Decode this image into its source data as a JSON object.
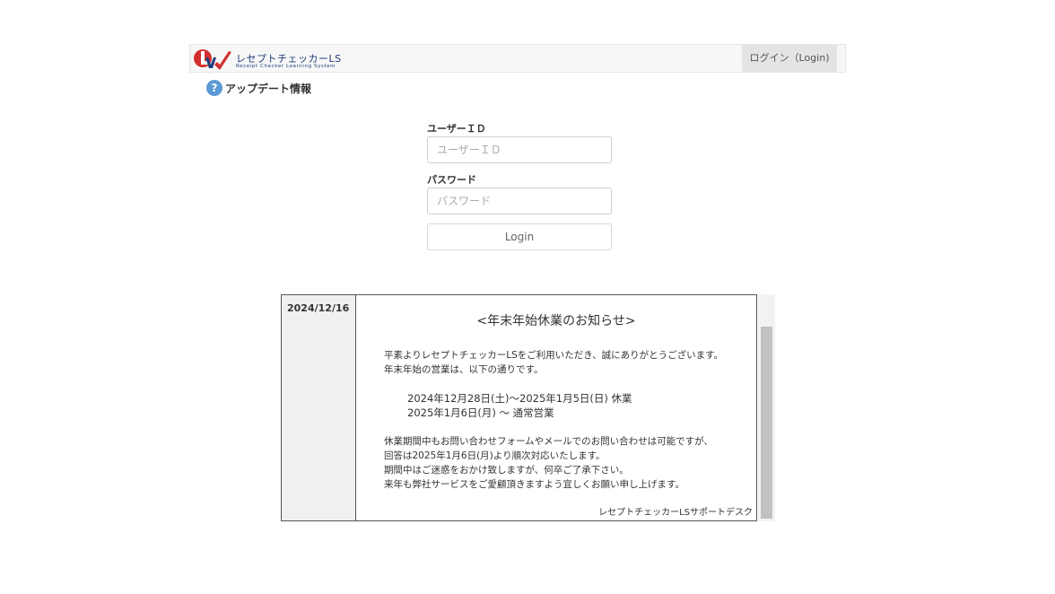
{
  "header": {
    "logo_title": "レセプトチェッカーLS",
    "logo_subtitle": "Receipt Checker Learning System",
    "login_link": "ログイン（Login)"
  },
  "update_info": {
    "icon": "question-icon",
    "label": "アップデート情報"
  },
  "login_form": {
    "user_id_label": "ユーザーＩＤ",
    "user_id_placeholder": "ユーザーＩＤ",
    "user_id_value": "",
    "password_label": "パスワード",
    "password_placeholder": "パスワード",
    "password_value": "",
    "login_button": "Login"
  },
  "news": {
    "date": "2024/12/16",
    "title": "<年末年始休業のお知らせ>",
    "lines": [
      "平素よりレセプトチェッカーLSをご利用いただき、誠にありがとうございます。",
      "年末年始の営業は、以下の通りです。",
      "",
      "2024年12月28日(土)～2025年1月5日(日)  休業",
      "2025年1月6日(月) ～ 通常営業",
      "",
      "休業期間中もお問い合わせフォームやメールでのお問い合わせは可能ですが、",
      "回答は2025年1月6日(月)より順次対応いたします。",
      "期間中はご迷惑をおかけ致しますが、何卒ご了承下さい。",
      "来年も弊社サービスをご愛顧頂きますよう宜しくお願い申し上げます。"
    ],
    "signature": "レセプトチェッカーLSサポートデスク"
  },
  "colors": {
    "logo_red": "#d32f2f",
    "logo_blue": "#1f3c7a",
    "help_icon": "#5b9bd5"
  }
}
